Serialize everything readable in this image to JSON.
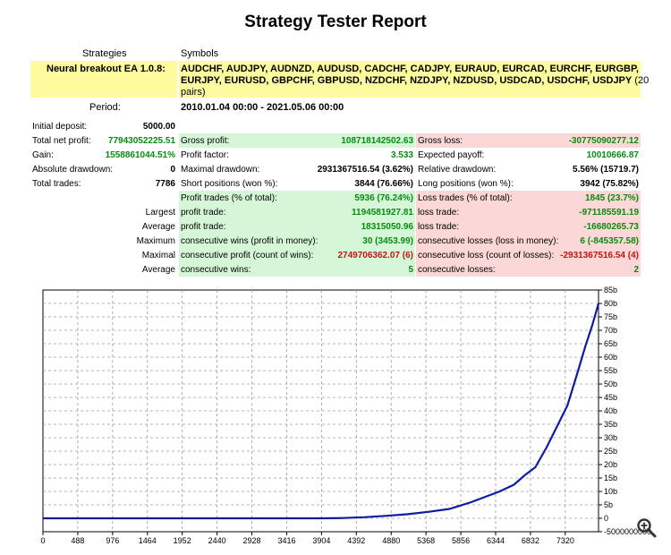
{
  "report": {
    "title": "Strategy Tester Report"
  },
  "header": {
    "strategies_label": "Strategies",
    "symbols_label": "Symbols",
    "strategy_name": "Neural breakout EA 1.0.8:",
    "symbols_line1": "AUDCHF, AUDJPY, AUDNZD, AUDUSD, CADCHF, CADJPY, EURAUD, EURCAD, EURCHF, EURGBP,",
    "symbols_line2": "EURJPY, EURUSD, GBPCHF, GBPUSD, NZDCHF, NZDJPY, NZDUSD, USDCAD, USDCHF, USDJPY",
    "symbols_count_part1": "(20",
    "symbols_count_part2": "pairs)",
    "period_label": "Period:",
    "period_value": "2010.01.04 00:00 - 2021.05.06 00:00"
  },
  "col1": [
    {
      "label": "Initial deposit:",
      "value": "5000.00"
    },
    {
      "label": "Total net profit:",
      "value": "77943052225.51"
    },
    {
      "label": "Gain:",
      "value": "1558861044.51%"
    },
    {
      "label": "Absolute drawdown:",
      "value": "0"
    },
    {
      "label": "Total trades:",
      "value": "7786"
    }
  ],
  "col2": [
    {
      "label": "Gross profit:",
      "value": "108718142502.63"
    },
    {
      "label": "Profit factor:",
      "value": "3.533"
    },
    {
      "label": "Maximal drawdown:",
      "value": "2931367516.54 (3.62%)"
    },
    {
      "label": "Short positions (won %):",
      "value": "3844 (76.66%)"
    },
    {
      "label": "Profit trades (% of total):",
      "value": "5936 (76.24%)"
    }
  ],
  "col3": [
    {
      "label": "Gross loss:",
      "value": "-30775090277.12"
    },
    {
      "label": "Expected payoff:",
      "value": "10010666.87"
    },
    {
      "label": "Relative drawdown:",
      "value": "5.56% (15719.7)"
    },
    {
      "label": "Long positions (won %):",
      "value": "3942 (75.82%)"
    },
    {
      "label": "Loss trades (% of total):",
      "value": "1845 (23.7%)"
    }
  ],
  "extra": [
    {
      "prefix": "Largest",
      "p_label": "profit trade:",
      "p_value": "1194581927.81",
      "l_label": "loss trade:",
      "l_value": "-971185591.19"
    },
    {
      "prefix": "Average",
      "p_label": "profit trade:",
      "p_value": "18315050.96",
      "l_label": "loss trade:",
      "l_value": "-16680265.73"
    },
    {
      "prefix": "Maximum",
      "p_label": "consecutive wins (profit in money):",
      "p_value": "30 (3453.99)",
      "l_label": "consecutive losses (loss in money):",
      "l_value": "6 (-845357.58)"
    },
    {
      "prefix": "Maximal",
      "p_label": "consecutive profit (count of wins):",
      "p_value": "2749706362.07 (6)",
      "l_label": "consecutive loss (count of losses):",
      "l_value": "-2931367516.54 (4)"
    },
    {
      "prefix": "Average",
      "p_label": "consecutive wins:",
      "p_value": "5",
      "l_label": "consecutive losses:",
      "l_value": "2"
    }
  ],
  "colors": {
    "yellow": "#fdfb9d",
    "green_bg": "#d5f7d8",
    "red_bg": "#fbd7d7",
    "green_text": "#0a8a12",
    "red_text": "#c01515",
    "balance_line": "#0f1c9e"
  },
  "chart_data": {
    "type": "line",
    "xlabel": "",
    "ylabel": "",
    "x_ticks": [
      "0",
      "488",
      "976",
      "1464",
      "1952",
      "2440",
      "2928",
      "3416",
      "3904",
      "4392",
      "4880",
      "5368",
      "5856",
      "6344",
      "6832",
      "7320"
    ],
    "y_ticks": [
      "85b",
      "80b",
      "75b",
      "70b",
      "65b",
      "60b",
      "55b",
      "50b",
      "45b",
      "40b",
      "35b",
      "30b",
      "25b",
      "20b",
      "15b",
      "10b",
      "5b",
      "0",
      "-5000000000"
    ],
    "xlim": [
      0,
      7786
    ],
    "ylim": [
      -5000000000,
      85000000000
    ],
    "grid": true,
    "series": [
      {
        "x": [
          0,
          488,
          976,
          1464,
          1952,
          2440,
          2928,
          3416,
          3904,
          4200,
          4500,
          4800,
          5100,
          5400,
          5700,
          6000,
          6200,
          6400,
          6600,
          6750,
          6900,
          7050,
          7200,
          7350,
          7500,
          7600,
          7700,
          7786
        ],
        "y": [
          0,
          0,
          0,
          0,
          0,
          0,
          0,
          0,
          0,
          100000000,
          400000000,
          900000000,
          1500000000,
          2400000000,
          3500000000,
          6000000000,
          8000000000,
          10000000000,
          12500000000,
          16000000000,
          19000000000,
          26000000000,
          34000000000,
          42000000000,
          55000000000,
          64000000000,
          72000000000,
          80000000000
        ]
      }
    ]
  },
  "zoom_icon": "magnifier-icon"
}
